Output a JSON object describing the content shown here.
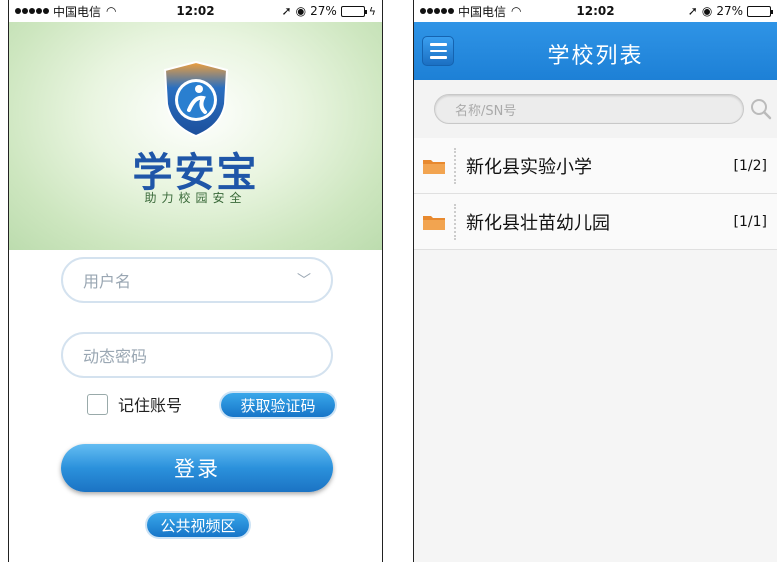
{
  "status_bar": {
    "carrier": "中国电信",
    "time": "12:02",
    "battery": "27%"
  },
  "login_screen": {
    "app_name": "学安宝",
    "slogan": "助力校园安全",
    "username_placeholder": "用户名",
    "otp_placeholder": "动态密码",
    "remember_label": "记住账号",
    "get_code_label": "获取验证码",
    "login_label": "登录",
    "public_video_label": "公共视频区",
    "colors": {
      "brand_blue": "#1f56a8",
      "button_blue": "#2b91dc",
      "hero_green": "#cde6bf"
    }
  },
  "school_list_screen": {
    "title": "学校列表",
    "search_placeholder": "名称/SN号",
    "schools": [
      {
        "name": "新化县实验小学",
        "count": "[1/2]"
      },
      {
        "name": "新化县壮苗幼儿园",
        "count": "[1/1]"
      }
    ],
    "colors": {
      "nav_blue": "#1d80d6",
      "folder_orange": "#e8892e"
    }
  }
}
